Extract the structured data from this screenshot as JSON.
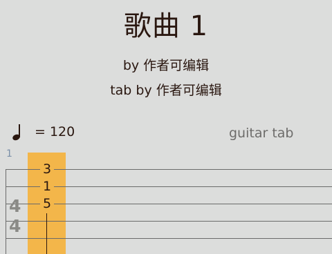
{
  "score": {
    "title": "歌曲 1",
    "artist": "by 作者可编辑",
    "tab_author": "tab by 作者可编辑"
  },
  "tempo": {
    "icon": "quarter-note-icon",
    "value": "= 120"
  },
  "track": {
    "instrument": "guitar tab"
  },
  "measure": {
    "number": "1",
    "time_signature_top": "4",
    "time_signature_bottom": "4",
    "beat_frets": [
      "3",
      "1",
      "5"
    ]
  },
  "colors": {
    "background": "#dcdddc",
    "cursor_highlight": "#f3b64a",
    "text": "#2a1710",
    "staff_line": "#6a6a6a",
    "measure_number": "#7a8fa8"
  }
}
